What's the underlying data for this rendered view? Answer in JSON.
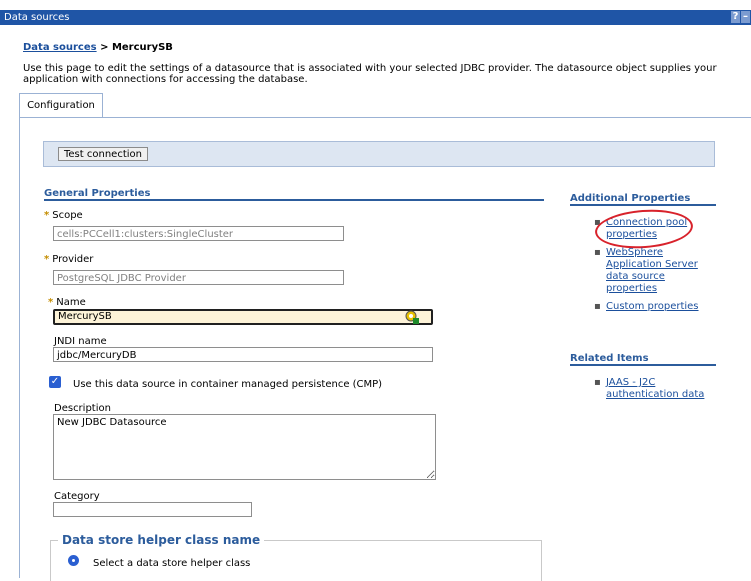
{
  "window": {
    "title": "Data sources",
    "help_label": "?",
    "minimize_label": "–"
  },
  "breadcrumb": {
    "parent": "Data sources",
    "separator": " > ",
    "current": "MercurySB"
  },
  "intro": "Use this page to edit the settings of a datasource that is associated with your selected JDBC provider. The datasource object supplies your application with connections for accessing the database.",
  "tabs": [
    {
      "label": "Configuration"
    }
  ],
  "toolbar": {
    "test_connection_label": "Test connection"
  },
  "general": {
    "title": "General Properties",
    "required_marker": "*",
    "scope_label": "Scope",
    "scope_value": "cells:PCCell1:clusters:SingleCluster",
    "provider_label": "Provider",
    "provider_value": "PostgreSQL JDBC Provider",
    "name_label": "Name",
    "name_value": "MercurySB",
    "jndi_label": "JNDI name",
    "jndi_value": "jdbc/MercuryDB",
    "cmp_label": "Use this data source in container managed persistence (CMP)",
    "cmp_checked": true,
    "description_label": "Description",
    "description_value": "New JDBC Datasource",
    "category_label": "Category",
    "category_value": "",
    "helper_title": "Data store helper class name",
    "helper_option": "Select a data store helper class"
  },
  "additional": {
    "title": "Additional Properties",
    "links": [
      {
        "label": "Connection pool properties"
      },
      {
        "label": "WebSphere Application Server data source properties"
      },
      {
        "label": "Custom properties"
      }
    ]
  },
  "related": {
    "title": "Related Items",
    "links": [
      {
        "label": "JAAS - J2C authentication data"
      }
    ]
  },
  "colors": {
    "titlebar": "#1f55a6",
    "link": "#1b4f9c",
    "section": "#2c5c9c",
    "annotation_circle": "#d8222b"
  },
  "icons": {
    "password_helper": "key-helper-icon",
    "bullet": "bullet-icon"
  }
}
